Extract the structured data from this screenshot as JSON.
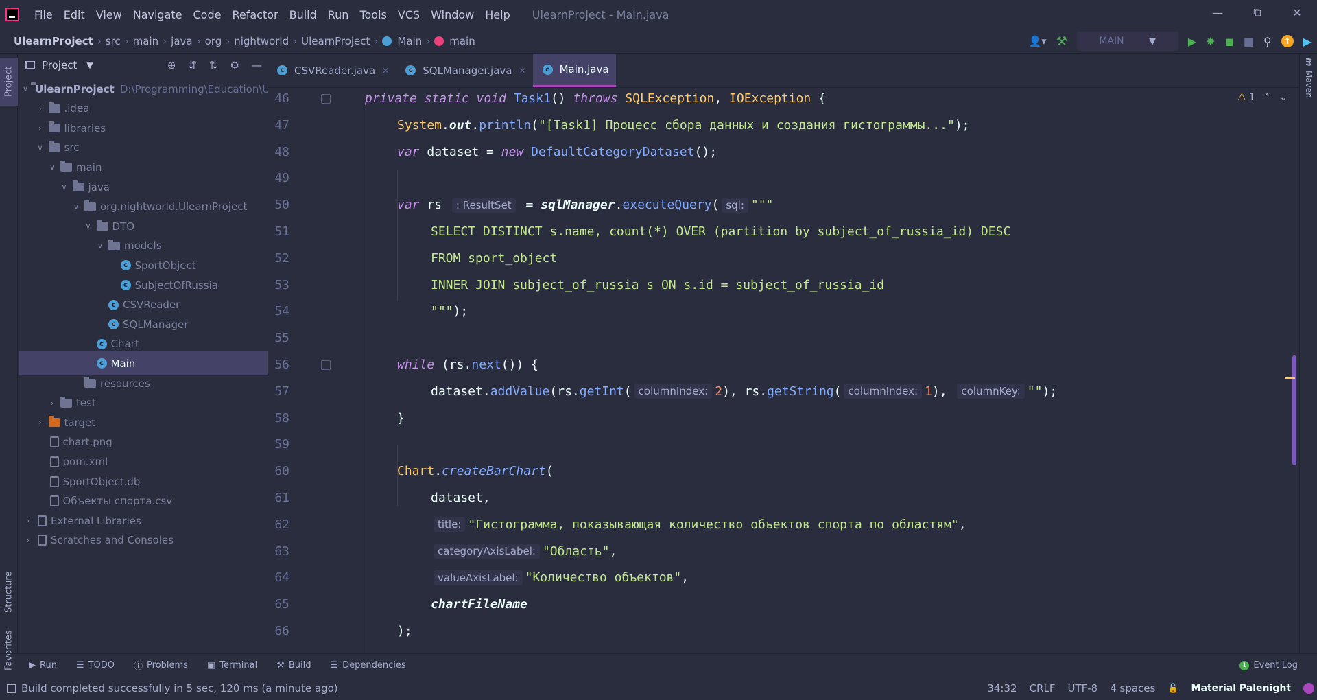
{
  "menu": [
    "File",
    "Edit",
    "View",
    "Navigate",
    "Code",
    "Refactor",
    "Build",
    "Run",
    "Tools",
    "VCS",
    "Window",
    "Help"
  ],
  "window_title": "UlearnProject - Main.java",
  "breadcrumbs": [
    "UlearnProject",
    "src",
    "main",
    "java",
    "org",
    "nightworld",
    "UlearnProject",
    "Main",
    "main"
  ],
  "run_config": "MAIN",
  "project_panel": {
    "title": "Project",
    "tree": [
      {
        "label": "UlearnProject",
        "path": "D:\\Programming\\Education\\Ulearn",
        "icon": "folder-icon",
        "arrow": "down",
        "level": 0,
        "bold": true
      },
      {
        "label": ".idea",
        "icon": "folder-icon",
        "arrow": "right",
        "level": 1
      },
      {
        "label": "libraries",
        "icon": "folder-icon",
        "arrow": "right",
        "level": 1
      },
      {
        "label": "src",
        "icon": "folder-icon",
        "arrow": "down",
        "level": 1
      },
      {
        "label": "main",
        "icon": "folder-icon",
        "arrow": "down",
        "level": 2
      },
      {
        "label": "java",
        "icon": "folder-icon",
        "arrow": "down",
        "level": 3
      },
      {
        "label": "org.nightworld.UlearnProject",
        "icon": "package-icon",
        "arrow": "down",
        "level": 4
      },
      {
        "label": "DTO",
        "icon": "package-icon",
        "arrow": "down",
        "level": 5
      },
      {
        "label": "models",
        "icon": "package-icon",
        "arrow": "down",
        "level": 6
      },
      {
        "label": "SportObject",
        "icon": "class-icon",
        "arrow": "",
        "level": 7
      },
      {
        "label": "SubjectOfRussia",
        "icon": "class-icon",
        "arrow": "",
        "level": 7
      },
      {
        "label": "CSVReader",
        "icon": "class-icon",
        "arrow": "",
        "level": 6
      },
      {
        "label": "SQLManager",
        "icon": "class-icon",
        "arrow": "",
        "level": 6
      },
      {
        "label": "Chart",
        "icon": "class-icon",
        "arrow": "",
        "level": 5
      },
      {
        "label": "Main",
        "icon": "main-class-icon",
        "arrow": "",
        "level": 5,
        "selected": true
      },
      {
        "label": "resources",
        "icon": "resources-folder-icon",
        "arrow": "",
        "level": 4
      },
      {
        "label": "test",
        "icon": "folder-icon",
        "arrow": "right",
        "level": 2
      },
      {
        "label": "target",
        "icon": "excluded-folder-icon",
        "arrow": "right",
        "level": 1
      },
      {
        "label": "chart.png",
        "icon": "image-file-icon",
        "arrow": "",
        "level": 1
      },
      {
        "label": "pom.xml",
        "icon": "maven-file-icon",
        "arrow": "",
        "level": 1
      },
      {
        "label": "SportObject.db",
        "icon": "db-file-icon",
        "arrow": "",
        "level": 1
      },
      {
        "label": "Объекты спорта.csv",
        "icon": "csv-file-icon",
        "arrow": "",
        "level": 1
      },
      {
        "label": "External Libraries",
        "icon": "library-icon",
        "arrow": "right",
        "level": 0
      },
      {
        "label": "Scratches and Consoles",
        "icon": "scratches-icon",
        "arrow": "right",
        "level": 0
      }
    ]
  },
  "left_strip": [
    "Project",
    "Structure",
    "Favorites"
  ],
  "right_strip": [
    "Maven"
  ],
  "tabs": [
    {
      "label": "CSVReader.java",
      "active": false
    },
    {
      "label": "SQLManager.java",
      "active": false
    },
    {
      "label": "Main.java",
      "active": true
    }
  ],
  "editor": {
    "warnings": "1",
    "lines": [
      {
        "n": "46",
        "tokens": [
          [
            "kw",
            "private static void "
          ],
          [
            "fn",
            "Task1"
          ],
          [
            "plain",
            "() "
          ],
          [
            "kw",
            "throws "
          ],
          [
            "cls",
            "SQLException"
          ],
          [
            "plain",
            ", "
          ],
          [
            "cls",
            "IOException"
          ],
          [
            "plain",
            " {"
          ]
        ]
      },
      {
        "n": "47",
        "tokens": [
          [
            "cls",
            "System"
          ],
          [
            "plain",
            "."
          ],
          [
            "bi",
            "out"
          ],
          [
            "plain",
            "."
          ],
          [
            "fn",
            "println"
          ],
          [
            "plain",
            "("
          ],
          [
            "str",
            "\"[Task1] Процесс сбора данных и создания гистограммы...\""
          ],
          [
            "plain",
            ");"
          ]
        ]
      },
      {
        "n": "48",
        "tokens": [
          [
            "kw",
            "var "
          ],
          [
            "plain",
            "dataset = "
          ],
          [
            "kw",
            "new "
          ],
          [
            "fn",
            "DefaultCategoryDataset"
          ],
          [
            "plain",
            "();"
          ]
        ]
      },
      {
        "n": "49",
        "tokens": []
      },
      {
        "n": "50",
        "tokens": [
          [
            "kw",
            "var "
          ],
          [
            "plain",
            "rs "
          ],
          [
            "hint",
            ": ResultSet"
          ],
          [
            "plain",
            " = "
          ],
          [
            "bi",
            "sqlManager"
          ],
          [
            "plain",
            "."
          ],
          [
            "fn",
            "executeQuery"
          ],
          [
            "plain",
            "("
          ],
          [
            "hint",
            "sql:"
          ],
          [
            "str",
            "\"\"\""
          ]
        ]
      },
      {
        "n": "51",
        "tokens": [
          [
            "inj",
            "SELECT DISTINCT s.name, count(*) OVER (partition by subject_of_russia_id) DESC"
          ]
        ]
      },
      {
        "n": "52",
        "tokens": [
          [
            "inj",
            "FROM sport_object"
          ]
        ]
      },
      {
        "n": "53",
        "tokens": [
          [
            "inj",
            "INNER JOIN subject_of_russia s ON s.id = subject_of_russia_id"
          ]
        ]
      },
      {
        "n": "54",
        "tokens": [
          [
            "str",
            "\"\"\""
          ],
          [
            "plain",
            ");"
          ]
        ]
      },
      {
        "n": "55",
        "tokens": []
      },
      {
        "n": "56",
        "tokens": [
          [
            "kw",
            "while "
          ],
          [
            "plain",
            "(rs."
          ],
          [
            "fn",
            "next"
          ],
          [
            "plain",
            "()) {"
          ]
        ]
      },
      {
        "n": "57",
        "tokens": [
          [
            "plain",
            "dataset."
          ],
          [
            "fn",
            "addValue"
          ],
          [
            "plain",
            "(rs."
          ],
          [
            "fn",
            "getInt"
          ],
          [
            "plain",
            "("
          ],
          [
            "hint",
            "columnIndex:"
          ],
          [
            "num",
            "2"
          ],
          [
            "plain",
            "), rs."
          ],
          [
            "fn",
            "getString"
          ],
          [
            "plain",
            "("
          ],
          [
            "hint",
            "columnIndex:"
          ],
          [
            "num",
            "1"
          ],
          [
            "plain",
            "), "
          ],
          [
            "hint",
            "columnKey:"
          ],
          [
            "str",
            "\"\""
          ],
          [
            "plain",
            ");"
          ]
        ]
      },
      {
        "n": "58",
        "tokens": [
          [
            "plain",
            "}"
          ]
        ]
      },
      {
        "n": "59",
        "tokens": []
      },
      {
        "n": "60",
        "tokens": [
          [
            "cls",
            "Chart"
          ],
          [
            "plain",
            "."
          ],
          [
            "it",
            "createBarChart"
          ],
          [
            "plain",
            "("
          ]
        ]
      },
      {
        "n": "61",
        "tokens": [
          [
            "plain",
            "dataset,"
          ]
        ]
      },
      {
        "n": "62",
        "tokens": [
          [
            "hint",
            "title:"
          ],
          [
            "str",
            "\"Гистограмма, показывающая количество объектов спорта по областям\""
          ],
          [
            "plain",
            ","
          ]
        ]
      },
      {
        "n": "63",
        "tokens": [
          [
            "hint",
            "categoryAxisLabel:"
          ],
          [
            "str",
            "\"Область\""
          ],
          [
            "plain",
            ","
          ]
        ]
      },
      {
        "n": "64",
        "tokens": [
          [
            "hint",
            "valueAxisLabel:"
          ],
          [
            "str",
            "\"Количество объектов\""
          ],
          [
            "plain",
            ","
          ]
        ]
      },
      {
        "n": "65",
        "tokens": [
          [
            "bi",
            "chartFileName"
          ]
        ]
      },
      {
        "n": "66",
        "tokens": [
          [
            "plain",
            ");"
          ]
        ]
      }
    ]
  },
  "toolwindows": [
    "Run",
    "TODO",
    "Problems",
    "Terminal",
    "Build",
    "Dependencies"
  ],
  "event_log": {
    "label": "Event Log",
    "count": "1"
  },
  "status": {
    "message": "Build completed successfully in 5 sec, 120 ms (a minute ago)",
    "position": "34:32",
    "line_sep": "CRLF",
    "encoding": "UTF-8",
    "indent": "4 spaces",
    "theme": "Material Palenight"
  }
}
